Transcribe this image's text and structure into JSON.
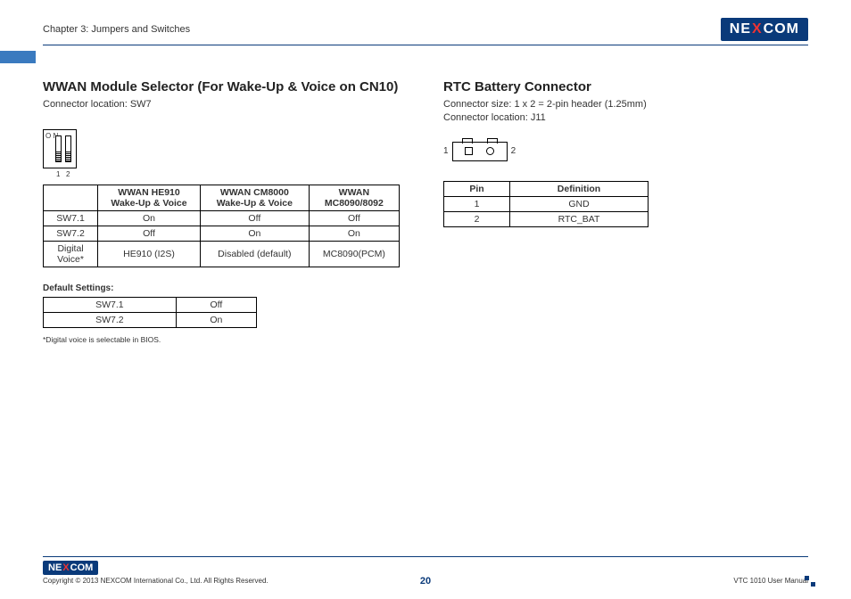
{
  "header": {
    "chapter": "Chapter 3: Jumpers and Switches",
    "brand_pre": "NE",
    "brand_x": "X",
    "brand_post": "COM"
  },
  "left": {
    "title": "WWAN Module Selector (For Wake-Up & Voice on CN10)",
    "location": "Connector location: SW7",
    "switch_on": "O N",
    "switch_num1": "1",
    "switch_num2": "2",
    "table": {
      "h1": "WWAN HE910 Wake-Up & Voice",
      "h2": "WWAN CM8000 Wake-Up & Voice",
      "h3": "WWAN MC8090/8092",
      "r1c0": "SW7.1",
      "r1c1": "On",
      "r1c2": "Off",
      "r1c3": "Off",
      "r2c0": "SW7.2",
      "r2c1": "Off",
      "r2c2": "On",
      "r2c3": "On",
      "r3c0": "Digital Voice*",
      "r3c1": "HE910 (I2S)",
      "r3c2": "Disabled (default)",
      "r3c3": "MC8090(PCM)"
    },
    "default_label": "Default Settings:",
    "default_table": {
      "r1c0": "SW7.1",
      "r1c1": "Off",
      "r2c0": "SW7.2",
      "r2c1": "On"
    },
    "footnote": "*Digital voice is selectable in BIOS."
  },
  "right": {
    "title": "RTC Battery Connector",
    "size": "Connector size: 1 x 2 = 2-pin header (1.25mm)",
    "location": "Connector location: J11",
    "pin1": "1",
    "pin2": "2",
    "pin_table": {
      "hPin": "Pin",
      "hDef": "Definition",
      "r1c0": "1",
      "r1c1": "GND",
      "r2c0": "2",
      "r2c1": "RTC_BAT"
    }
  },
  "footer": {
    "copyright": "Copyright © 2013 NEXCOM International Co., Ltd. All Rights Reserved.",
    "page": "20",
    "manual": "VTC 1010 User Manual"
  }
}
